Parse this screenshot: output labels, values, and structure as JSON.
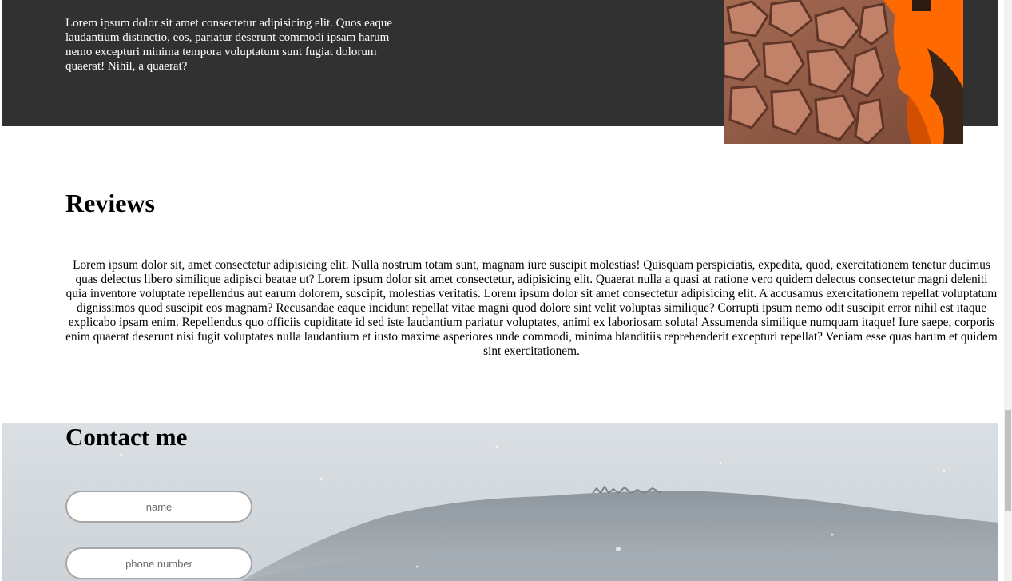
{
  "about": {
    "text": "Lorem ipsum dolor sit amet consectetur adipisicing elit. Quos eaque laudantium distinctio, eos, pariatur deserunt commodi ipsam harum nemo excepturi minima tempora voluptatum sunt fugiat dolorum quaerat! Nihil, a quaerat?"
  },
  "reviews": {
    "title": "Reviews",
    "text": "Lorem ipsum dolor sit, amet consectetur adipisicing elit. Nulla nostrum totam sunt, magnam iure suscipit molestias! Quisquam perspiciatis, expedita, quod, exercitationem tenetur ducimus quas delectus libero similique adipisci beatae ut? Lorem ipsum dolor sit amet consectetur, adipisicing elit. Quaerat nulla a quasi at ratione vero quidem delectus consectetur magni deleniti quia inventore voluptate repellendus aut earum dolorem, suscipit, molestias veritatis. Lorem ipsum dolor sit amet consectetur adipisicing elit. A accusamus exercitationem repellat voluptatum dignissimos quod suscipit eos magnam? Recusandae eaque incidunt repellat vitae magni quod dolore sint velit voluptas similique? Corrupti ipsum nemo odit suscipit error nihil est itaque explicabo ipsam enim. Repellendus quo officiis cupiditate id sed iste laudantium pariatur voluptates, animi ex laboriosam soluta! Assumenda similique numquam itaque! Iure saepe, corporis enim quaerat deserunt nisi fugit voluptates nulla laudantium et iusto maxime asperiores unde commodi, minima blanditiis reprehenderit excepturi repellat? Veniam esse quas harum et quidem sint exercitationem."
  },
  "contact": {
    "title": "Contact me",
    "name_value": "",
    "name_placeholder": "name",
    "phone_value": "",
    "phone_placeholder": "phone number"
  },
  "colors": {
    "about_background": "#313131",
    "about_text": "#ffffff",
    "accent_orange": "#ff6a00",
    "contact_sky": "#d4d9de"
  }
}
